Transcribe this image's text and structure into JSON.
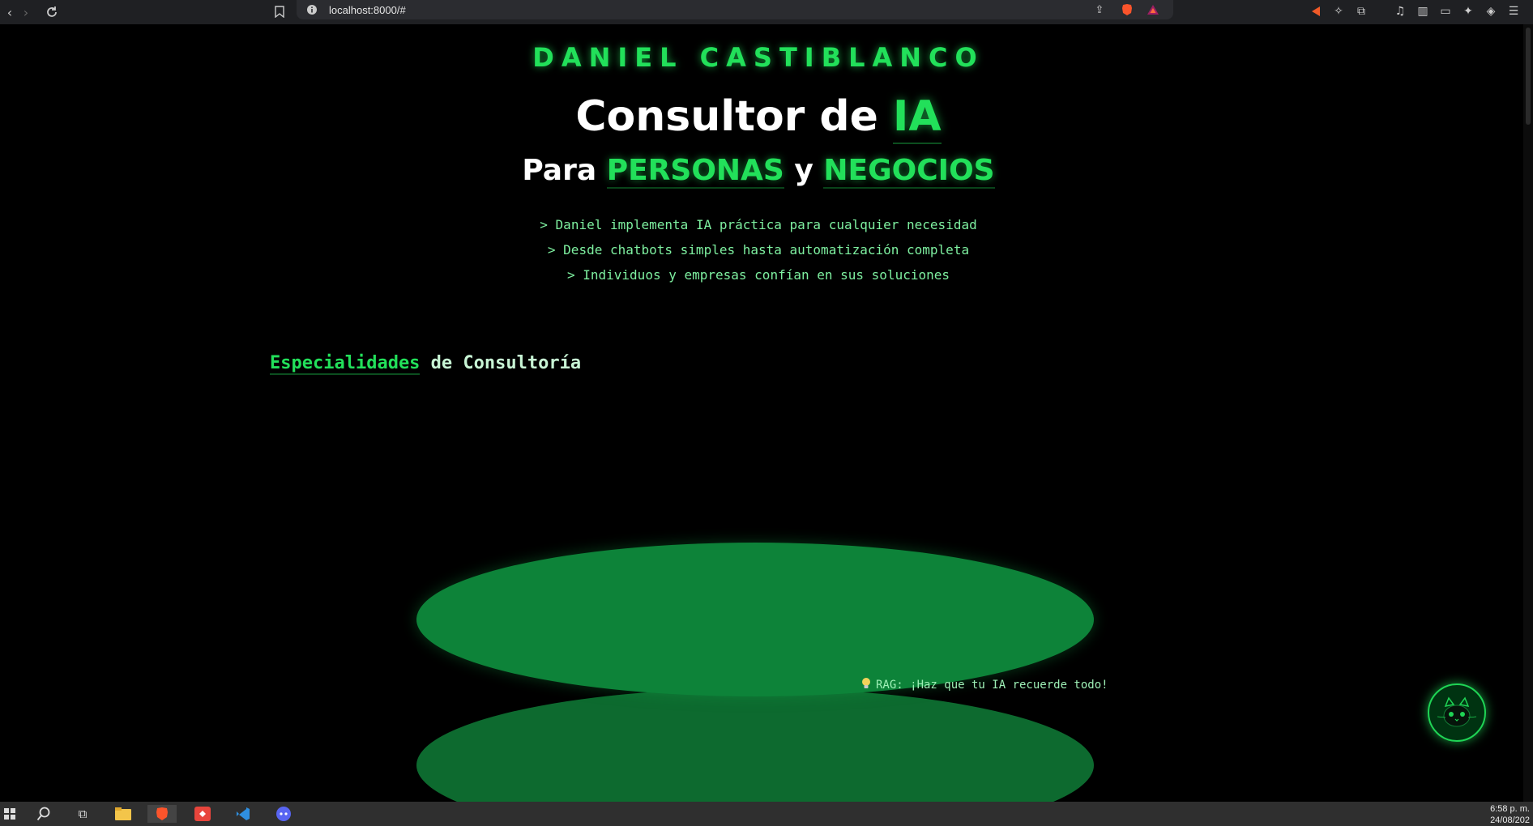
{
  "browser": {
    "url": "localhost:8000/#"
  },
  "hero": {
    "brand": "DANIEL CASTIBLANCO",
    "title_prefix": "Consultor de ",
    "title_highlight": "IA",
    "subtitle_prefix": "Para ",
    "subtitle_highlight_1": "PERSONAS",
    "subtitle_middle": " y ",
    "subtitle_highlight_2": "NEGOCIOS",
    "lines": [
      "> Daniel implementa IA práctica para cualquier necesidad",
      "> Desde chatbots simples hasta automatización completa",
      "> Individuos y empresas confían en sus soluciones"
    ]
  },
  "specialties": {
    "title_highlight": "Especialidades",
    "title_rest": " de Consultoría",
    "tip": "RAG: ¡Haz que tu IA recuerde todo!"
  },
  "taskbar": {
    "time": "6:58 p. m.",
    "date": "24/08/202"
  },
  "colors": {
    "accent": "#22e05a",
    "background": "#000000",
    "disc_top": "#0d8339",
    "disc_bottom": "#0d6a2f"
  }
}
